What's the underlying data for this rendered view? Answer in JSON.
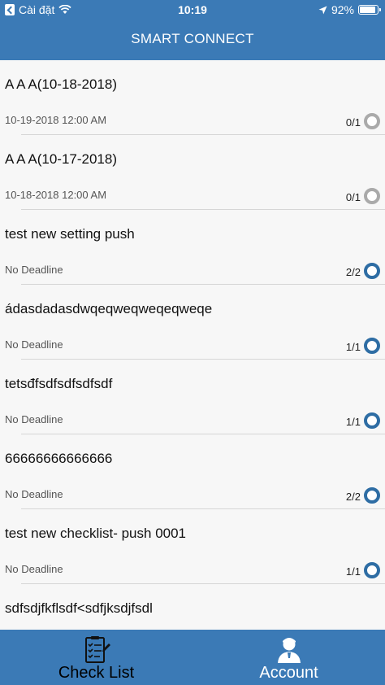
{
  "status_bar": {
    "back_app": "Cài đặt",
    "time": "10:19",
    "battery_percent": "92%",
    "battery_level": 0.92
  },
  "header": {
    "title": "SMART CONNECT"
  },
  "checklists": [
    {
      "title": "A A A(10-18-2018)",
      "deadline": "10-19-2018 12:00 AM",
      "progress": "0/1",
      "complete": false
    },
    {
      "title": "A A A(10-17-2018)",
      "deadline": "10-18-2018 12:00 AM",
      "progress": "0/1",
      "complete": false
    },
    {
      "title": "test new setting push",
      "deadline": "No Deadline",
      "progress": "2/2",
      "complete": true
    },
    {
      "title": "ádasdadasdwqeqweqweqeqweqe",
      "deadline": "No Deadline",
      "progress": "1/1",
      "complete": true
    },
    {
      "title": "tetsđfsdfsdfsdfsdf",
      "deadline": "No Deadline",
      "progress": "1/1",
      "complete": true
    },
    {
      "title": "66666666666666",
      "deadline": "No Deadline",
      "progress": "2/2",
      "complete": true
    },
    {
      "title": "test new checklist- push 0001",
      "deadline": "No Deadline",
      "progress": "1/1",
      "complete": true
    },
    {
      "title": "sdfsdjfkflsdf<sdfjksdjfsdl",
      "deadline": "",
      "progress": "",
      "complete": true
    }
  ],
  "tabbar": {
    "checklist": {
      "label": "Check List",
      "icon": "checklist-icon",
      "selected": true
    },
    "account": {
      "label": "Account",
      "icon": "account-icon",
      "selected": false
    }
  },
  "colors": {
    "brand": "#3b7ab6",
    "complete": "#2e6da4",
    "incomplete": "#aaaaaa"
  }
}
